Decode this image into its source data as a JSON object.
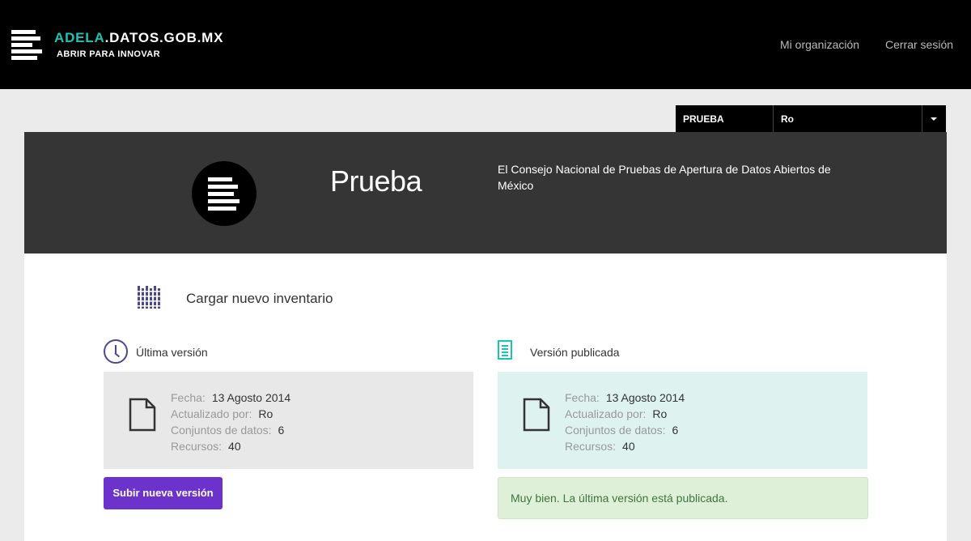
{
  "navbar": {
    "brand_accent": "ADELA",
    "brand_rest": ".DATOS.GOB.MX",
    "tagline": "ABRIR PARA INNOVAR",
    "links": [
      "Mi organización",
      "Cerrar sesión"
    ]
  },
  "org_selector": {
    "organization": "PRUEBA",
    "user": "Ro"
  },
  "org": {
    "name": "Prueba",
    "description": "El Consejo Nacional de Pruebas de Apertura de Datos Abiertos de México"
  },
  "upload": {
    "label": "Cargar nuevo inventario"
  },
  "latest": {
    "heading": "Última versión",
    "fields": [
      {
        "key": "Fecha:",
        "value": "13 Agosto 2014"
      },
      {
        "key": "Actualizado por:",
        "value": "Ro"
      },
      {
        "key": "Conjuntos de datos:",
        "value": "6"
      },
      {
        "key": "Recursos:",
        "value": "40"
      }
    ],
    "button": "Subir nueva versión"
  },
  "published": {
    "heading": "Versión publicada",
    "fields": [
      {
        "key": "Fecha:",
        "value": "13 Agosto 2014"
      },
      {
        "key": "Actualizado por:",
        "value": "Ro"
      },
      {
        "key": "Conjuntos de datos:",
        "value": "6"
      },
      {
        "key": "Recursos:",
        "value": "40"
      }
    ],
    "alert": "Muy bien. La última versión está publicada."
  },
  "colors": {
    "accent_teal": "#1cc4b4",
    "button_purple": "#6b33cc",
    "alert_green_bg": "#dff0d8",
    "alert_green_text": "#3c763d",
    "icon_purple": "#4a4890"
  },
  "icons": {
    "brand": "stacked-bars-logo-icon",
    "upload": "barcode-grid-icon",
    "latest": "clock-icon",
    "published": "document-lines-icon",
    "file": "file-icon"
  }
}
